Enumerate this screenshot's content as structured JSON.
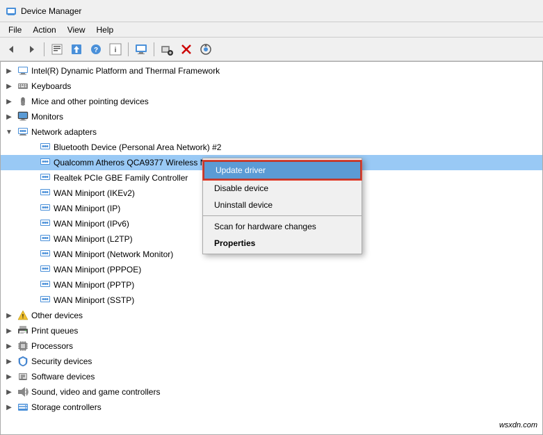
{
  "titleBar": {
    "title": "Device Manager",
    "iconLabel": "device-manager-icon"
  },
  "menuBar": {
    "items": [
      {
        "id": "menu-file",
        "label": "File"
      },
      {
        "id": "menu-action",
        "label": "Action"
      },
      {
        "id": "menu-view",
        "label": "View"
      },
      {
        "id": "menu-help",
        "label": "Help"
      }
    ]
  },
  "toolbar": {
    "buttons": [
      {
        "id": "btn-back",
        "label": "←",
        "name": "back-button"
      },
      {
        "id": "btn-forward",
        "label": "→",
        "name": "forward-button"
      },
      {
        "id": "btn-properties",
        "label": "📋",
        "name": "properties-button"
      },
      {
        "id": "btn-update",
        "label": "⬆",
        "name": "update-button"
      },
      {
        "id": "btn-help",
        "label": "?",
        "name": "help-button"
      },
      {
        "id": "btn-unknown",
        "label": "▣",
        "name": "unknown-button"
      },
      {
        "id": "btn-scan",
        "label": "🖥",
        "name": "scan-button"
      },
      {
        "id": "btn-add",
        "label": "+",
        "name": "add-button"
      },
      {
        "id": "btn-delete",
        "label": "✕",
        "name": "delete-button"
      },
      {
        "id": "btn-download",
        "label": "⊕",
        "name": "download-button"
      }
    ]
  },
  "treeItems": [
    {
      "id": "item-intel",
      "label": "Intel(R) Dynamic Platform and Thermal Framework",
      "indent": 1,
      "expanded": false,
      "hasChildren": true,
      "type": "computer"
    },
    {
      "id": "item-keyboards",
      "label": "Keyboards",
      "indent": 1,
      "expanded": false,
      "hasChildren": true,
      "type": "keyboard"
    },
    {
      "id": "item-mice",
      "label": "Mice and other pointing devices",
      "indent": 1,
      "expanded": false,
      "hasChildren": true,
      "type": "mouse"
    },
    {
      "id": "item-monitors",
      "label": "Monitors",
      "indent": 1,
      "expanded": false,
      "hasChildren": true,
      "type": "monitor"
    },
    {
      "id": "item-network",
      "label": "Network adapters",
      "indent": 1,
      "expanded": true,
      "hasChildren": true,
      "type": "network"
    },
    {
      "id": "item-bluetooth",
      "label": "Bluetooth Device (Personal Area Network) #2",
      "indent": 2,
      "expanded": false,
      "hasChildren": false,
      "type": "network"
    },
    {
      "id": "item-qualcomm",
      "label": "Qualcomm Atheros QCA9377 Wireless Network Adapter",
      "indent": 2,
      "expanded": false,
      "hasChildren": false,
      "type": "network",
      "selected": true
    },
    {
      "id": "item-realtek",
      "label": "Realtek PCIe GBE Family Controller",
      "indent": 2,
      "expanded": false,
      "hasChildren": false,
      "type": "network"
    },
    {
      "id": "item-wan-ikev2",
      "label": "WAN Miniport (IKEv2)",
      "indent": 2,
      "expanded": false,
      "hasChildren": false,
      "type": "network"
    },
    {
      "id": "item-wan-ip",
      "label": "WAN Miniport (IP)",
      "indent": 2,
      "expanded": false,
      "hasChildren": false,
      "type": "network"
    },
    {
      "id": "item-wan-ipv6",
      "label": "WAN Miniport (IPv6)",
      "indent": 2,
      "expanded": false,
      "hasChildren": false,
      "type": "network"
    },
    {
      "id": "item-wan-l2tp",
      "label": "WAN Miniport (L2TP)",
      "indent": 2,
      "expanded": false,
      "hasChildren": false,
      "type": "network"
    },
    {
      "id": "item-wan-netmon",
      "label": "WAN Miniport (Network Monitor)",
      "indent": 2,
      "expanded": false,
      "hasChildren": false,
      "type": "network"
    },
    {
      "id": "item-wan-pppoe",
      "label": "WAN Miniport (PPPOE)",
      "indent": 2,
      "expanded": false,
      "hasChildren": false,
      "type": "network"
    },
    {
      "id": "item-wan-pptp",
      "label": "WAN Miniport (PPTP)",
      "indent": 2,
      "expanded": false,
      "hasChildren": false,
      "type": "network"
    },
    {
      "id": "item-wan-sstp",
      "label": "WAN Miniport (SSTP)",
      "indent": 2,
      "expanded": false,
      "hasChildren": false,
      "type": "network"
    },
    {
      "id": "item-other",
      "label": "Other devices",
      "indent": 1,
      "expanded": false,
      "hasChildren": true,
      "type": "warning"
    },
    {
      "id": "item-print",
      "label": "Print queues",
      "indent": 1,
      "expanded": false,
      "hasChildren": true,
      "type": "print"
    },
    {
      "id": "item-processors",
      "label": "Processors",
      "indent": 1,
      "expanded": false,
      "hasChildren": true,
      "type": "processor"
    },
    {
      "id": "item-security",
      "label": "Security devices",
      "indent": 1,
      "expanded": false,
      "hasChildren": true,
      "type": "security"
    },
    {
      "id": "item-software",
      "label": "Software devices",
      "indent": 1,
      "expanded": false,
      "hasChildren": true,
      "type": "software"
    },
    {
      "id": "item-sound",
      "label": "Sound, video and game controllers",
      "indent": 1,
      "expanded": false,
      "hasChildren": true,
      "type": "sound"
    },
    {
      "id": "item-storage",
      "label": "Storage controllers",
      "indent": 1,
      "expanded": false,
      "hasChildren": true,
      "type": "storage"
    }
  ],
  "contextMenu": {
    "items": [
      {
        "id": "ctx-update",
        "label": "Update driver",
        "highlighted": true,
        "bold": false,
        "name": "context-update-driver"
      },
      {
        "id": "ctx-disable",
        "label": "Disable device",
        "highlighted": false,
        "bold": false,
        "name": "context-disable-device"
      },
      {
        "id": "ctx-uninstall",
        "label": "Uninstall device",
        "highlighted": false,
        "bold": false,
        "name": "context-uninstall-device"
      },
      {
        "id": "ctx-sep",
        "label": "",
        "separator": true
      },
      {
        "id": "ctx-scan",
        "label": "Scan for hardware changes",
        "highlighted": false,
        "bold": false,
        "name": "context-scan-changes"
      },
      {
        "id": "ctx-properties",
        "label": "Properties",
        "highlighted": false,
        "bold": true,
        "name": "context-properties"
      }
    ]
  },
  "watermark": "wsxdn.com"
}
